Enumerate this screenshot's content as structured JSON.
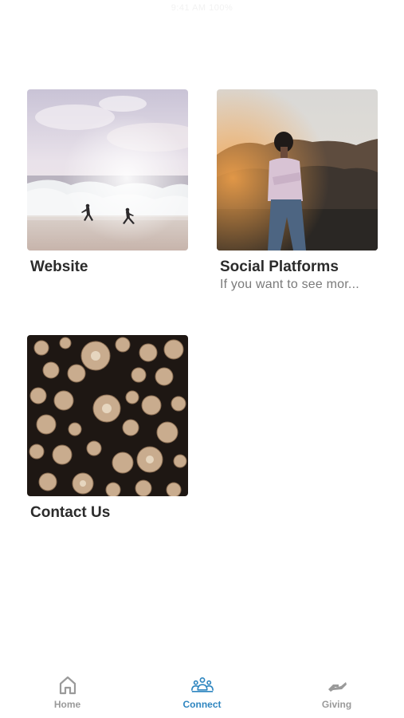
{
  "status_bar": {
    "text": "9:41 AM 100%"
  },
  "cards": [
    {
      "title": "Website",
      "subtitle": "",
      "image": "beach-runners-photo"
    },
    {
      "title": "Social Platforms",
      "subtitle": "If you want to see mor...",
      "image": "person-on-hill-photo"
    },
    {
      "title": "Contact Us",
      "subtitle": "",
      "image": "log-ends-photo"
    }
  ],
  "tabbar": {
    "active": "connect",
    "accent_color": "#2f86c0",
    "inactive_color": "#9a9a9a",
    "tabs": [
      {
        "id": "home",
        "label": "Home",
        "icon": "home-icon"
      },
      {
        "id": "connect",
        "label": "Connect",
        "icon": "people-group-icon"
      },
      {
        "id": "giving",
        "label": "Giving",
        "icon": "giving-hand-icon"
      }
    ]
  }
}
